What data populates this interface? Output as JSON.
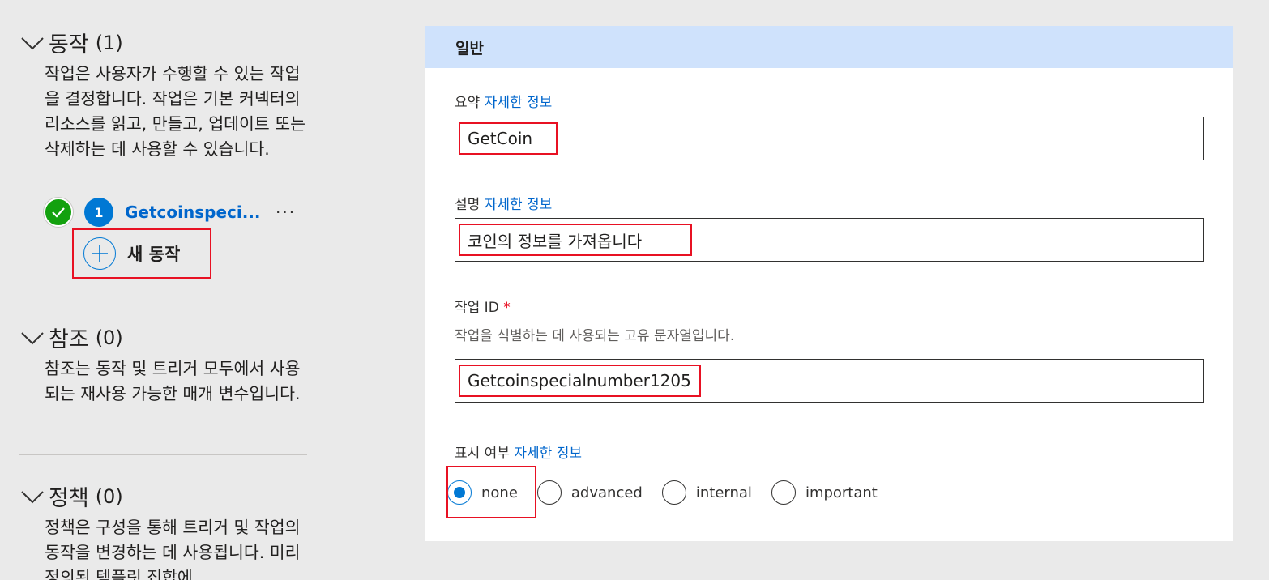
{
  "sections": [
    {
      "title": "동작",
      "count": "(1)",
      "description": "작업은 사용자가 수행할 수 있는 작업을 결정합니다. 작업은 기본 커넥터의 리소스를 읽고, 만들고, 업데이트 또는 삭제하는 데 사용할 수 있습니다."
    },
    {
      "title": "참조",
      "count": "(0)",
      "description": "참조는 동작 및 트리거 모두에서 사용되는 재사용 가능한 매개 변수입니다."
    },
    {
      "title": "정책",
      "count": "(0)",
      "description": "정책은 구성을 통해 트리거 및 작업의 동작을 변경하는 데 사용됩니다. 미리 정의된 템플릿 집합에"
    }
  ],
  "action_item": {
    "number": "1",
    "name": "Getcoinspeci...",
    "more": "···"
  },
  "new_action_label": "새 동작",
  "panel": {
    "header": "일반",
    "summary": {
      "label": "요약",
      "link": "자세한 정보",
      "value": "GetCoin"
    },
    "description": {
      "label": "설명",
      "link": "자세한 정보",
      "value": "코인의 정보를 가져옵니다"
    },
    "operation_id": {
      "label": "작업 ID",
      "required": "*",
      "help": "작업을 식별하는 데 사용되는 고유 문자열입니다.",
      "value": "Getcoinspecialnumber1205"
    },
    "visibility": {
      "label": "표시 여부",
      "link": "자세한 정보",
      "options": [
        "none",
        "advanced",
        "internal",
        "important"
      ],
      "selected": "none"
    }
  },
  "colors": {
    "accent": "#0078d4",
    "link": "#0066cc",
    "highlight_border": "#e81123",
    "success": "#13a10e",
    "panel_header_bg": "#cfe2fc"
  }
}
